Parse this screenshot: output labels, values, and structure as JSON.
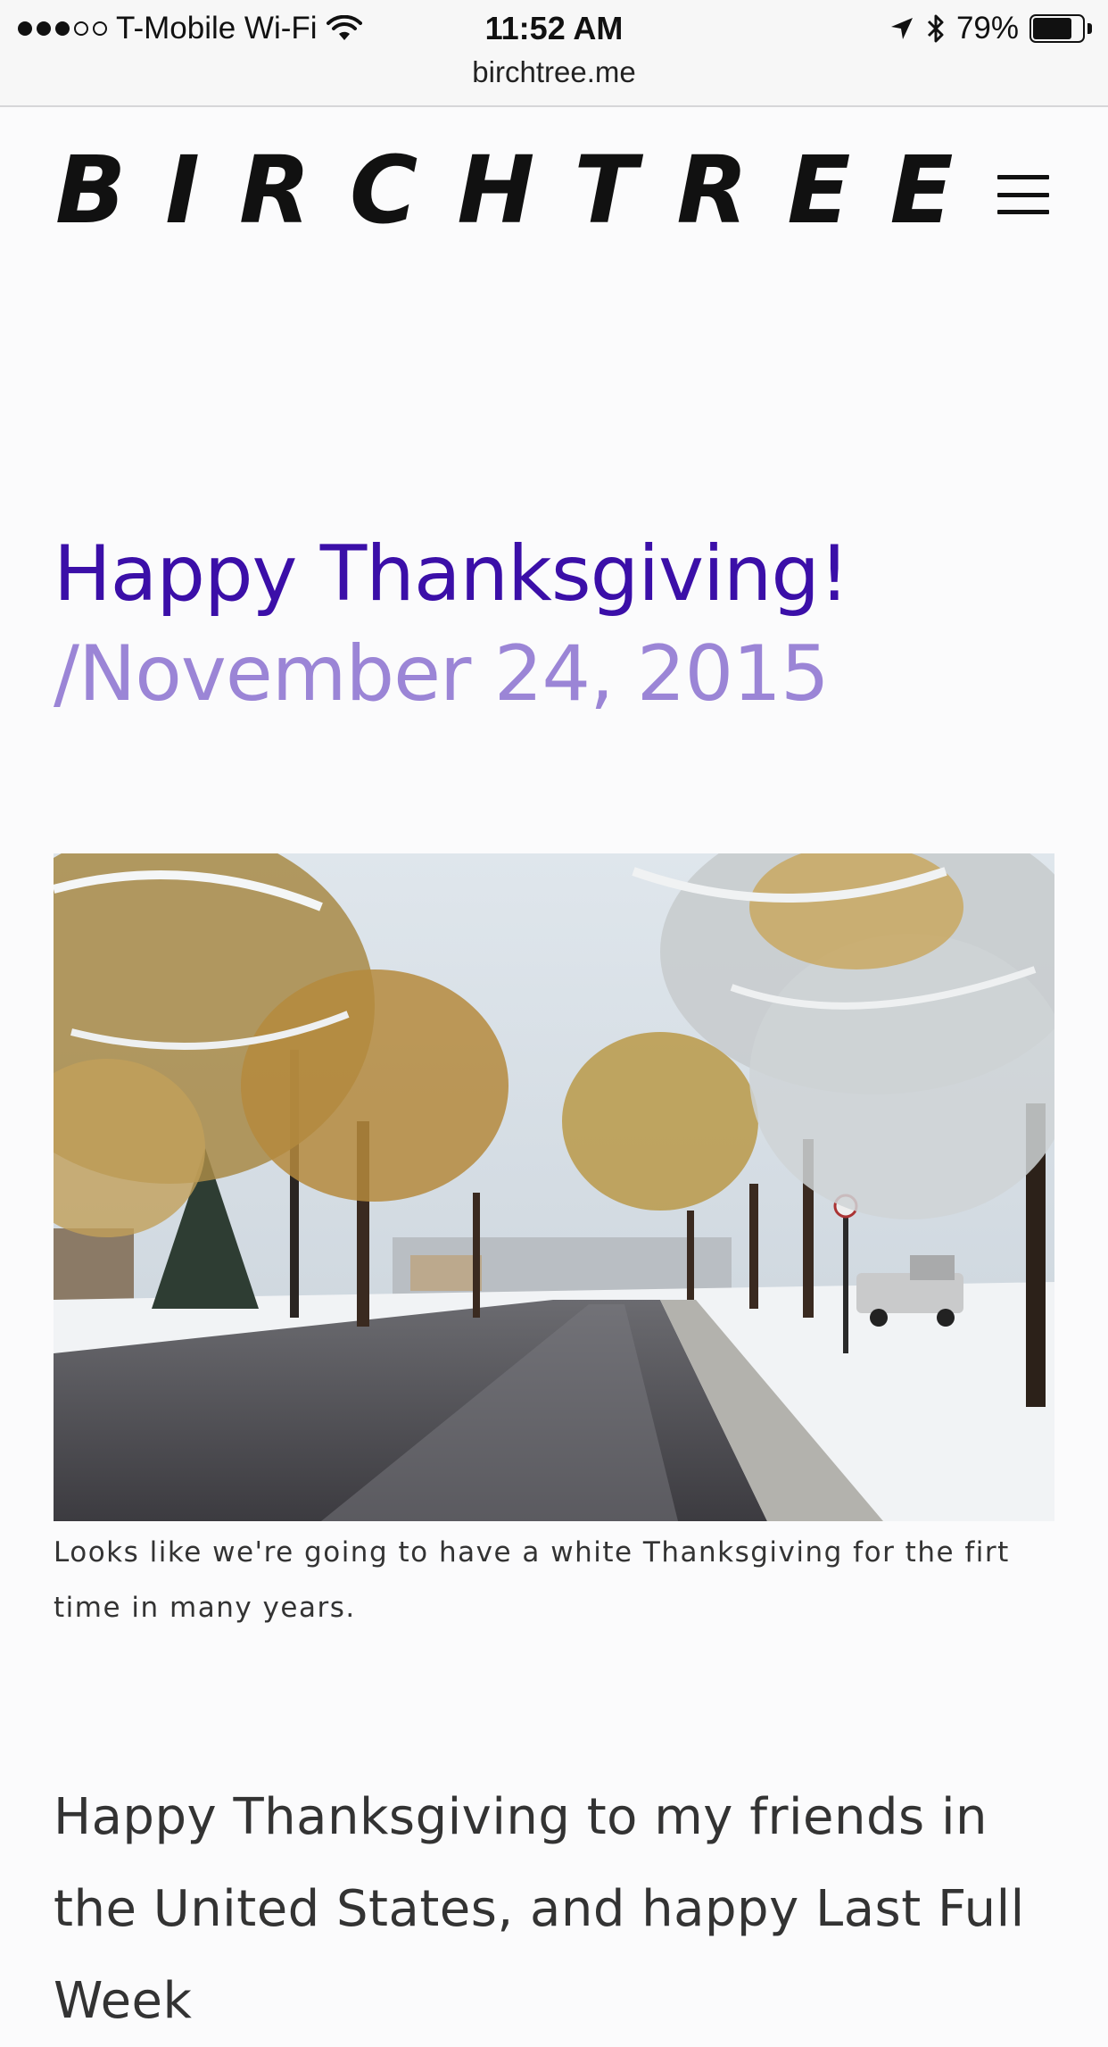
{
  "status_bar": {
    "carrier": "T-Mobile Wi-Fi",
    "signal_bars_filled": 3,
    "signal_bars_total": 5,
    "time": "11:52 AM",
    "battery_percent_label": "79%",
    "battery_level": 0.79,
    "icons": [
      "wifi-icon",
      "location-arrow-icon",
      "bluetooth-icon",
      "battery-icon"
    ]
  },
  "browser": {
    "url": "birchtree.me"
  },
  "site": {
    "brand": "BIRCHTREE",
    "menu_icon": "hamburger-menu-icon"
  },
  "post": {
    "title": "Happy Thanksgiving!",
    "date": "/November 24, 2015",
    "image_description_icon": "photo",
    "caption": "Looks like we're going to have a white Thanksgiving for the firt time in many years.",
    "body_start": "Happy Thanksgiving to my friends in the United States, and happy Last Full Week"
  },
  "colors": {
    "title": "#3b0fa8",
    "date": "#9b85d6",
    "text": "#333333",
    "background": "#fbfbfc"
  }
}
